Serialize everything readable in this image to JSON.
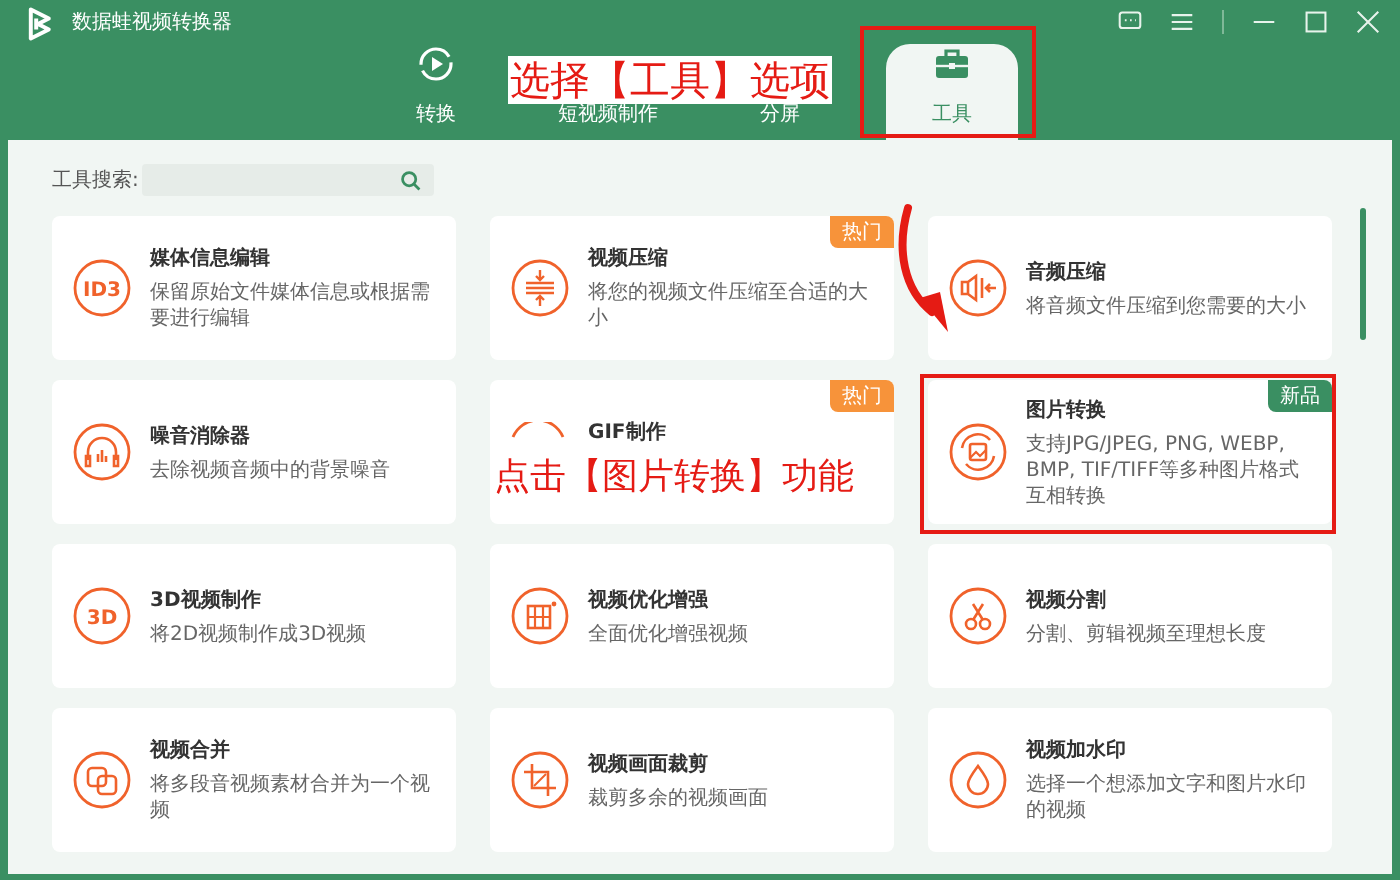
{
  "window": {
    "title": "数据蛙视频转换器"
  },
  "tabs": [
    {
      "label": "转换",
      "kind": "convert",
      "selected": false
    },
    {
      "label": "短视频制作",
      "kind": "covered",
      "selected": false
    },
    {
      "label": "分屏",
      "kind": "covered",
      "selected": false
    },
    {
      "label": "工具",
      "kind": "toolbox",
      "selected": true
    }
  ],
  "search": {
    "label": "工具搜索:"
  },
  "tools": [
    {
      "kind": "glyph",
      "icon_text": "ID3",
      "title": "媒体信息编辑",
      "description": "保留原始文件媒体信息或根据需要进行编辑"
    },
    {
      "kind": "compress",
      "title": "视频压缩",
      "description": "将您的视频文件压缩至合适的大小",
      "badge": {
        "text": "热门",
        "kind": "hot"
      }
    },
    {
      "kind": "audio-compress",
      "title": "音频压缩",
      "description": "将音频文件压缩到您需要的大小"
    },
    {
      "kind": "headphones",
      "title": "噪音消除器",
      "description": "去除视频音频中的背景噪音"
    },
    {
      "kind": "gif",
      "title": "GIF制作",
      "badge": {
        "text": "热门",
        "kind": "hot"
      }
    },
    {
      "kind": "image-convert",
      "title": "图片转换",
      "description": "支持JPG/JPEG, PNG, WEBP, BMP, TIF/TIFF等多种图片格式互相转换",
      "badge": {
        "text": "新品",
        "kind": "new"
      }
    },
    {
      "kind": "glyph",
      "icon_text": "3D",
      "title": "3D视频制作",
      "description": "将2D视频制作成3D视频"
    },
    {
      "kind": "film",
      "title": "视频优化增强",
      "description": "全面优化增强视频"
    },
    {
      "kind": "scissors",
      "title": "视频分割",
      "description": "分割、剪辑视频至理想长度"
    },
    {
      "kind": "merge",
      "title": "视频合并",
      "description": "将多段音视频素材合并为一个视频"
    },
    {
      "kind": "crop",
      "title": "视频画面裁剪",
      "description": "裁剪多余的视频画面"
    },
    {
      "kind": "drop",
      "title": "视频加水印",
      "description": "选择一个想添加文字和图片水印的视频"
    }
  ],
  "annotations": [
    {
      "kind": "caption",
      "text": "选择【工具】选项"
    },
    {
      "kind": "frame"
    },
    {
      "kind": "arrow"
    },
    {
      "kind": "caption",
      "text": "点击【图片转换】功能"
    },
    {
      "kind": "frame"
    }
  ]
}
